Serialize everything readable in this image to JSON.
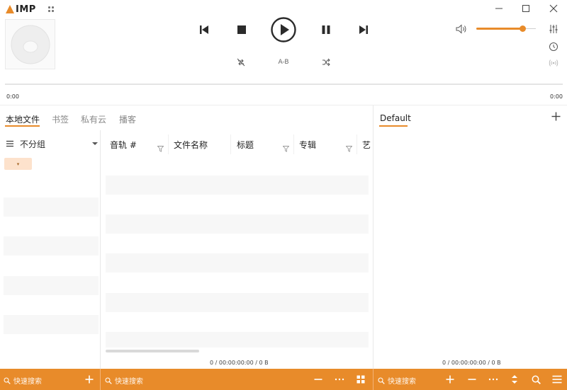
{
  "app": {
    "logo_text": "IMP"
  },
  "player": {
    "ab_label": "A-B",
    "time_current": "0:00",
    "time_total": "0:00",
    "volume_level": 0.78
  },
  "left_tabs": [
    {
      "label": "本地文件",
      "active": true
    },
    {
      "label": "书签",
      "active": false
    },
    {
      "label": "私有云",
      "active": false
    },
    {
      "label": "播客",
      "active": false
    }
  ],
  "groups": {
    "selector_label": "不分组"
  },
  "columns": [
    {
      "label": "音轨 #"
    },
    {
      "label": "文件名称"
    },
    {
      "label": "标题"
    },
    {
      "label": "专辑"
    },
    {
      "label": "艺"
    }
  ],
  "library_stats": "0 / 00:00:00:00 / 0 B",
  "playlist": {
    "title": "Default",
    "stats": "0 / 00:00:00:00 / 0 B"
  },
  "bottom": {
    "search_placeholder_1": "快速搜索",
    "search_placeholder_2": "快速搜索",
    "search_placeholder_3": "快速搜索"
  },
  "colors": {
    "accent": "#e88b2a"
  }
}
